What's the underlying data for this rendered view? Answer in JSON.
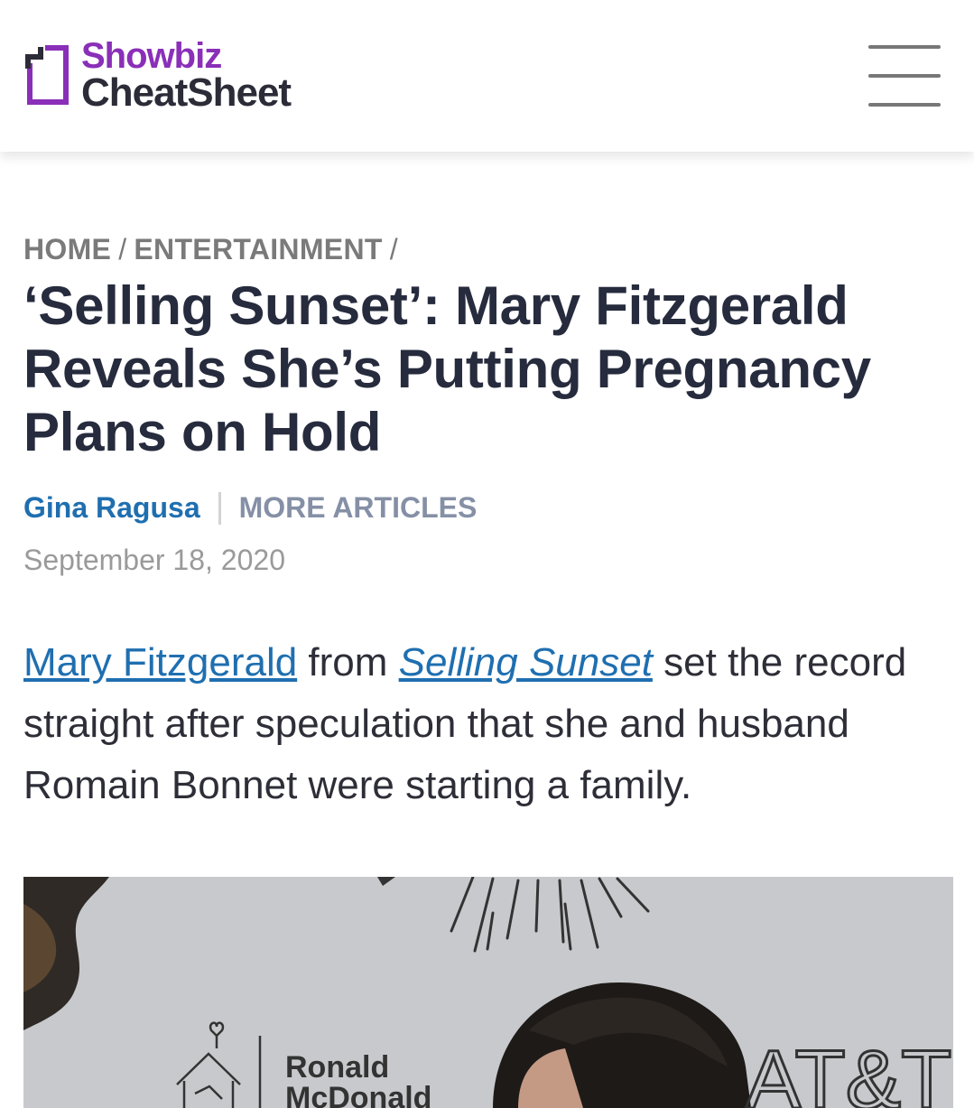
{
  "header": {
    "logo_line1": "Showbiz",
    "logo_line2": "CheatSheet",
    "menu_icon": "hamburger-menu-icon"
  },
  "breadcrumb": {
    "items": [
      "HOME",
      "ENTERTAINMENT"
    ],
    "separator": "/"
  },
  "article": {
    "title": "‘Selling Sunset’: Mary Fitzgerald Reveals She’s Putting Pregnancy Plans on Hold",
    "author": "Gina Ragusa",
    "more_articles": "MORE ARTICLES",
    "date": "September 18, 2020",
    "lead": {
      "link1": "Mary Fitzgerald",
      "text1": " from ",
      "link2": "Selling Sunset",
      "text2": " set the record straight after speculation that she and husband Romain Bonnet were starting a family."
    }
  },
  "photo": {
    "backdrop_text_1": "Ronald",
    "backdrop_text_2": "McDonald",
    "backdrop_text_3": "AT&T"
  },
  "colors": {
    "brand_purple": "#8a2fb8",
    "link_blue": "#1f6fb0",
    "title_navy": "#262b3d"
  }
}
